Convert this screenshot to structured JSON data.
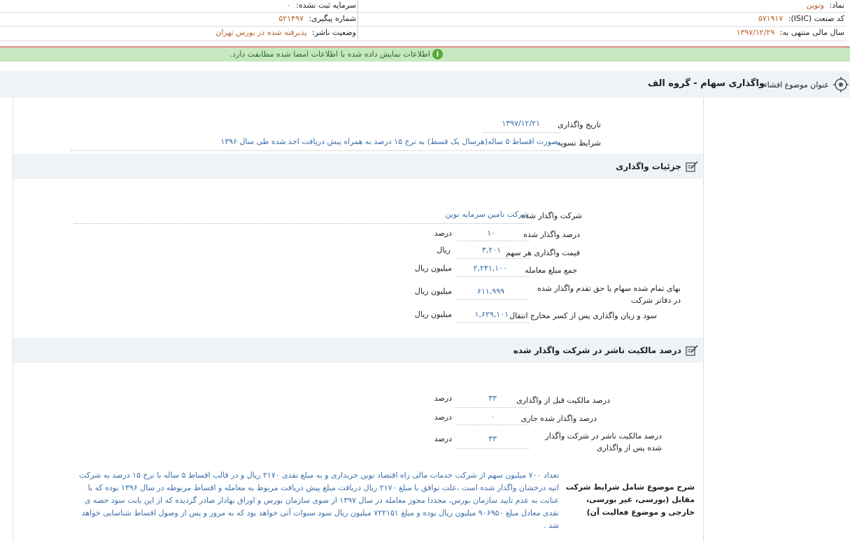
{
  "header": {
    "symbol_label": "نماد:",
    "symbol_value": "وتوین",
    "unregistered_capital_label": "سرمایه ثبت نشده:",
    "unregistered_capital_value": "۰",
    "isic_label": "کد صنعت (ISIC):",
    "isic_value": "۵۷۱۹۱۷",
    "tracking_label": "شماره پیگیری:",
    "tracking_value": "۵۲۱۴۹۷",
    "fiscal_label": "سال مالی منتهی به:",
    "fiscal_value": "۱۳۹۷/۱۲/۲۹",
    "status_label": "وضعیت ناشر:",
    "status_value": "پذیرفته شده در بورس تهران"
  },
  "notice": {
    "text": "اطلاعات نمایش داده شده با اطلاعات امضا شده مطابقت دارد.",
    "icon": "info-icon"
  },
  "subject": {
    "label": "عنوان موضوع افشاء:",
    "value": "واگذاری سهام - گروه الف"
  },
  "general": {
    "date_label": "تاریخ واگذاری",
    "date_value": "۱۳۹۷/۱۲/۲۱",
    "terms_label": "شرایط تسویه",
    "terms_value": "بصورت اقساط ۵ ساله(هرسال یک قسط) به نرخ ۱۵ درصد به همراه پیش دریافت اخذ شده طی سال ۱۳۹۶"
  },
  "details": {
    "title": "جزئیات واگذاری",
    "company_label": "شرکت واگذار شده",
    "company_value": "شرکت تامین سرمایه نوین",
    "rows": [
      {
        "label": "درصد واگذار شده",
        "value": "۱۰",
        "unit": "درصد"
      },
      {
        "label": "قیمت واگذاری هر سهم",
        "value": "۳,۲۰۱",
        "unit": "ریال"
      },
      {
        "label": "جمع مبلغ معامله",
        "value": "۲,۲۴۱,۱۰۰",
        "unit": "میلیون ریال"
      },
      {
        "label": "بهای تمام شده سهام یا حق تقدم واگذار شده در دفاتر شرکت",
        "value": "۶۱۱,۹۹۹",
        "unit": "میلیون ریال"
      },
      {
        "label": "سود و زیان واگذاری پس از کسر مخارج انتقال",
        "value": "۱,۶۲۹,۱۰۱",
        "unit": "میلیون ریال"
      }
    ]
  },
  "ownership": {
    "title": "درصد مالکیت ناشر در شرکت واگذار شده",
    "rows": [
      {
        "label": "درصد مالکیت قبل از واگذاری",
        "value": "۳۳",
        "unit": "درصد"
      },
      {
        "label": "درصد واگذار شده جاری",
        "value": "۰",
        "unit": "درصد"
      },
      {
        "label": "درصد مالکیت ناشر در شرکت واگذار شده پس از واگذاری",
        "value": "۳۳",
        "unit": "درصد"
      }
    ]
  },
  "description": {
    "label": "شرح موضوع شامل شرایط شرکت مقابل (بورسی، غیر بورسی، خارجی و موضوع فعالیت آن)",
    "text": "تعداد ۷۰۰ میلیون سهم از شرکت خدمات مالی راه اقتصاد نوین خریداری و به مبلغ نقدی ۲۱۷۰ ریال و در قالب اقساط ۵ ساله با نرخ ۱۵ درصد به شرکت اتیه درخشان واگذار شده است ،علت توافق با مبلغ ۲۱۷۰ ریال دریافت مبلغ پیش دریافت مربوط به معامله و اقساط مربوطه در سال ۱۳۹۶ بوده که با عنایت به عدم تایید سازمان بورس، مجددا مجوز معامله در سال ۱۳۹۷ از سوی سازمان بورس و اوراق بهادار صادر گردیده که از این بابت سود حصه ی نقدی معادل مبلغ ۹۰۶۹۵۰ میلیون ریال بوده و مبلغ ۷۲۲۱۵۱ میلیون ریال سود سنوات آتی خواهد بود که به مرور و پس از وصول اقساط شناسایی خواهد شد ."
  }
}
